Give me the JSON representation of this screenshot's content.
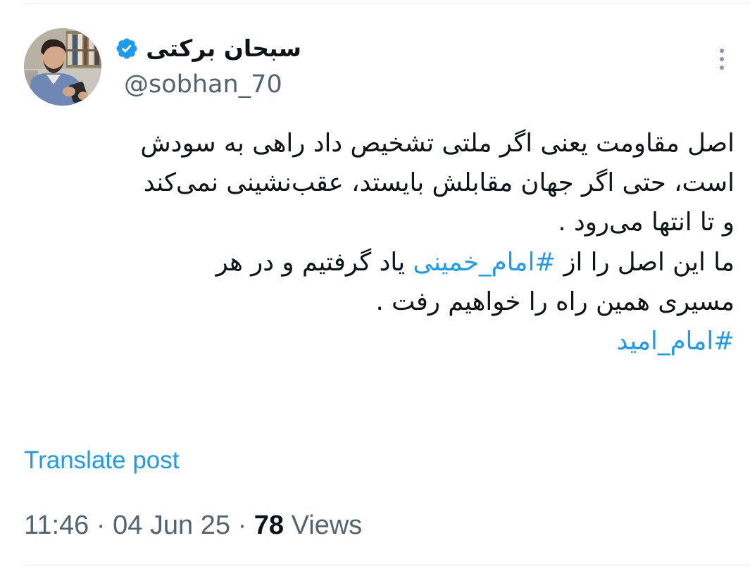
{
  "author": {
    "display_name": "سبحان برکتی",
    "handle": "@sobhan_70",
    "verified": true,
    "avatar_icon": "profile-photo"
  },
  "more_icon": "more-vertical-icon",
  "post": {
    "lines": [
      [
        "اصل مقاومت یعنی اگر ملتی تشخیص داد راهی به سودش"
      ],
      [
        "است، حتی اگر جهان مقابلش بایستد، عقب‌نشینی نمی‌کند"
      ],
      [
        "و تا انتها می‌رود ."
      ],
      [
        "ما این اصل را از ",
        "#امام_خمینی",
        " یاد گرفتیم و در هر"
      ],
      [
        "مسیری همین راه را خواهیم رفت ."
      ],
      [
        "#امام_امید"
      ]
    ],
    "hashtags": [
      "#امام_خمینی",
      "#امام_امید"
    ]
  },
  "translate_label": "Translate post",
  "meta": {
    "time": "11:46",
    "separator": " · ",
    "date": "04 Jun 25",
    "views_count": "78",
    "views_label": " Views"
  },
  "colors": {
    "text": "#0f1419",
    "secondary": "#536471",
    "accent": "#1d9bf0",
    "verified_badge": "#1d9bf0"
  }
}
